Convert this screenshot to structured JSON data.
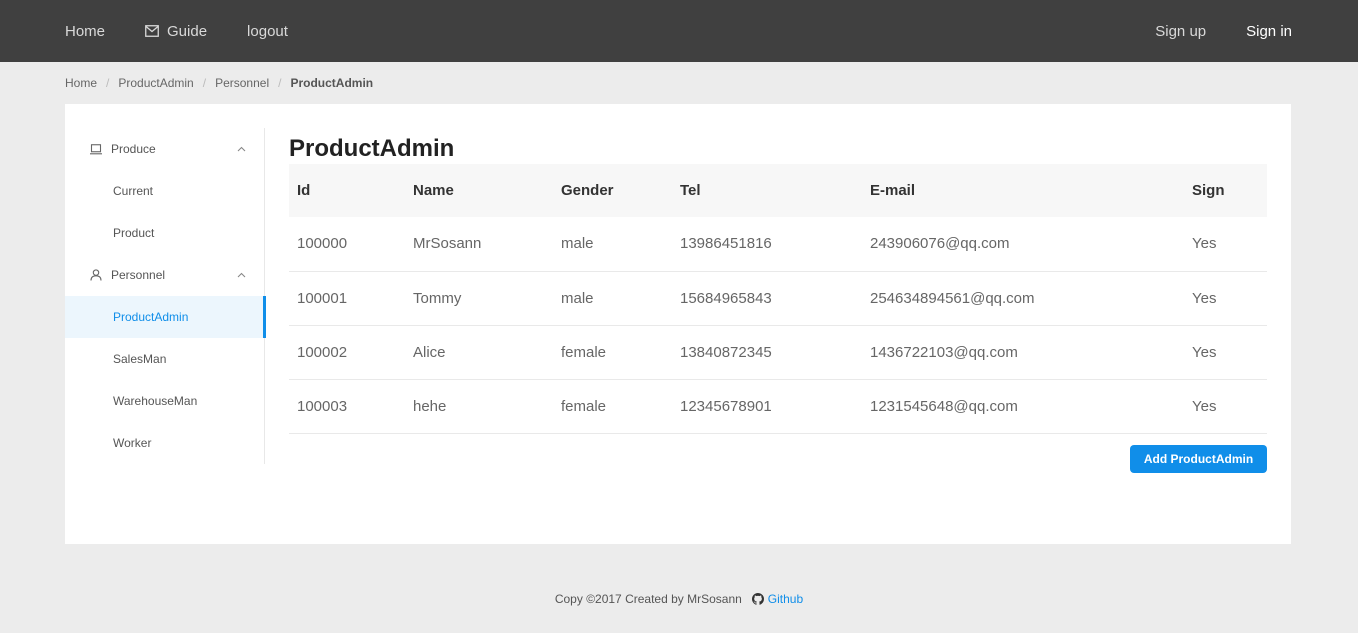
{
  "nav": {
    "home": "Home",
    "guide": "Guide",
    "logout": "logout",
    "signup": "Sign up",
    "signin": "Sign in"
  },
  "breadcrumb": [
    "Home",
    "ProductAdmin",
    "Personnel",
    "ProductAdmin"
  ],
  "sidebar": {
    "groups": [
      {
        "label": "Produce",
        "icon": "laptop-icon",
        "items": [
          "Current",
          "Product"
        ]
      },
      {
        "label": "Personnel",
        "icon": "user-icon",
        "items": [
          "ProductAdmin",
          "SalesMan",
          "WarehouseMan",
          "Worker"
        ]
      }
    ],
    "active": "ProductAdmin"
  },
  "main": {
    "title": "ProductAdmin",
    "columns": [
      "Id",
      "Name",
      "Gender",
      "Tel",
      "E-mail",
      "Sign"
    ],
    "rows": [
      [
        "100000",
        "MrSosann",
        "male",
        "13986451816",
        "243906076@qq.com",
        "Yes"
      ],
      [
        "100001",
        "Tommy",
        "male",
        "15684965843",
        "254634894561@qq.com",
        "Yes"
      ],
      [
        "100002",
        "Alice",
        "female",
        "13840872345",
        "1436722103@qq.com",
        "Yes"
      ],
      [
        "100003",
        "hehe",
        "female",
        "12345678901",
        "1231545648@qq.com",
        "Yes"
      ]
    ],
    "add_button": "Add ProductAdmin"
  },
  "footer": {
    "text": "Copy ©2017 Created by MrSosann",
    "github": "Github"
  },
  "colors": {
    "topbar": "#404040",
    "accent": "#108ee9",
    "active_bg": "#ecf6fd"
  }
}
